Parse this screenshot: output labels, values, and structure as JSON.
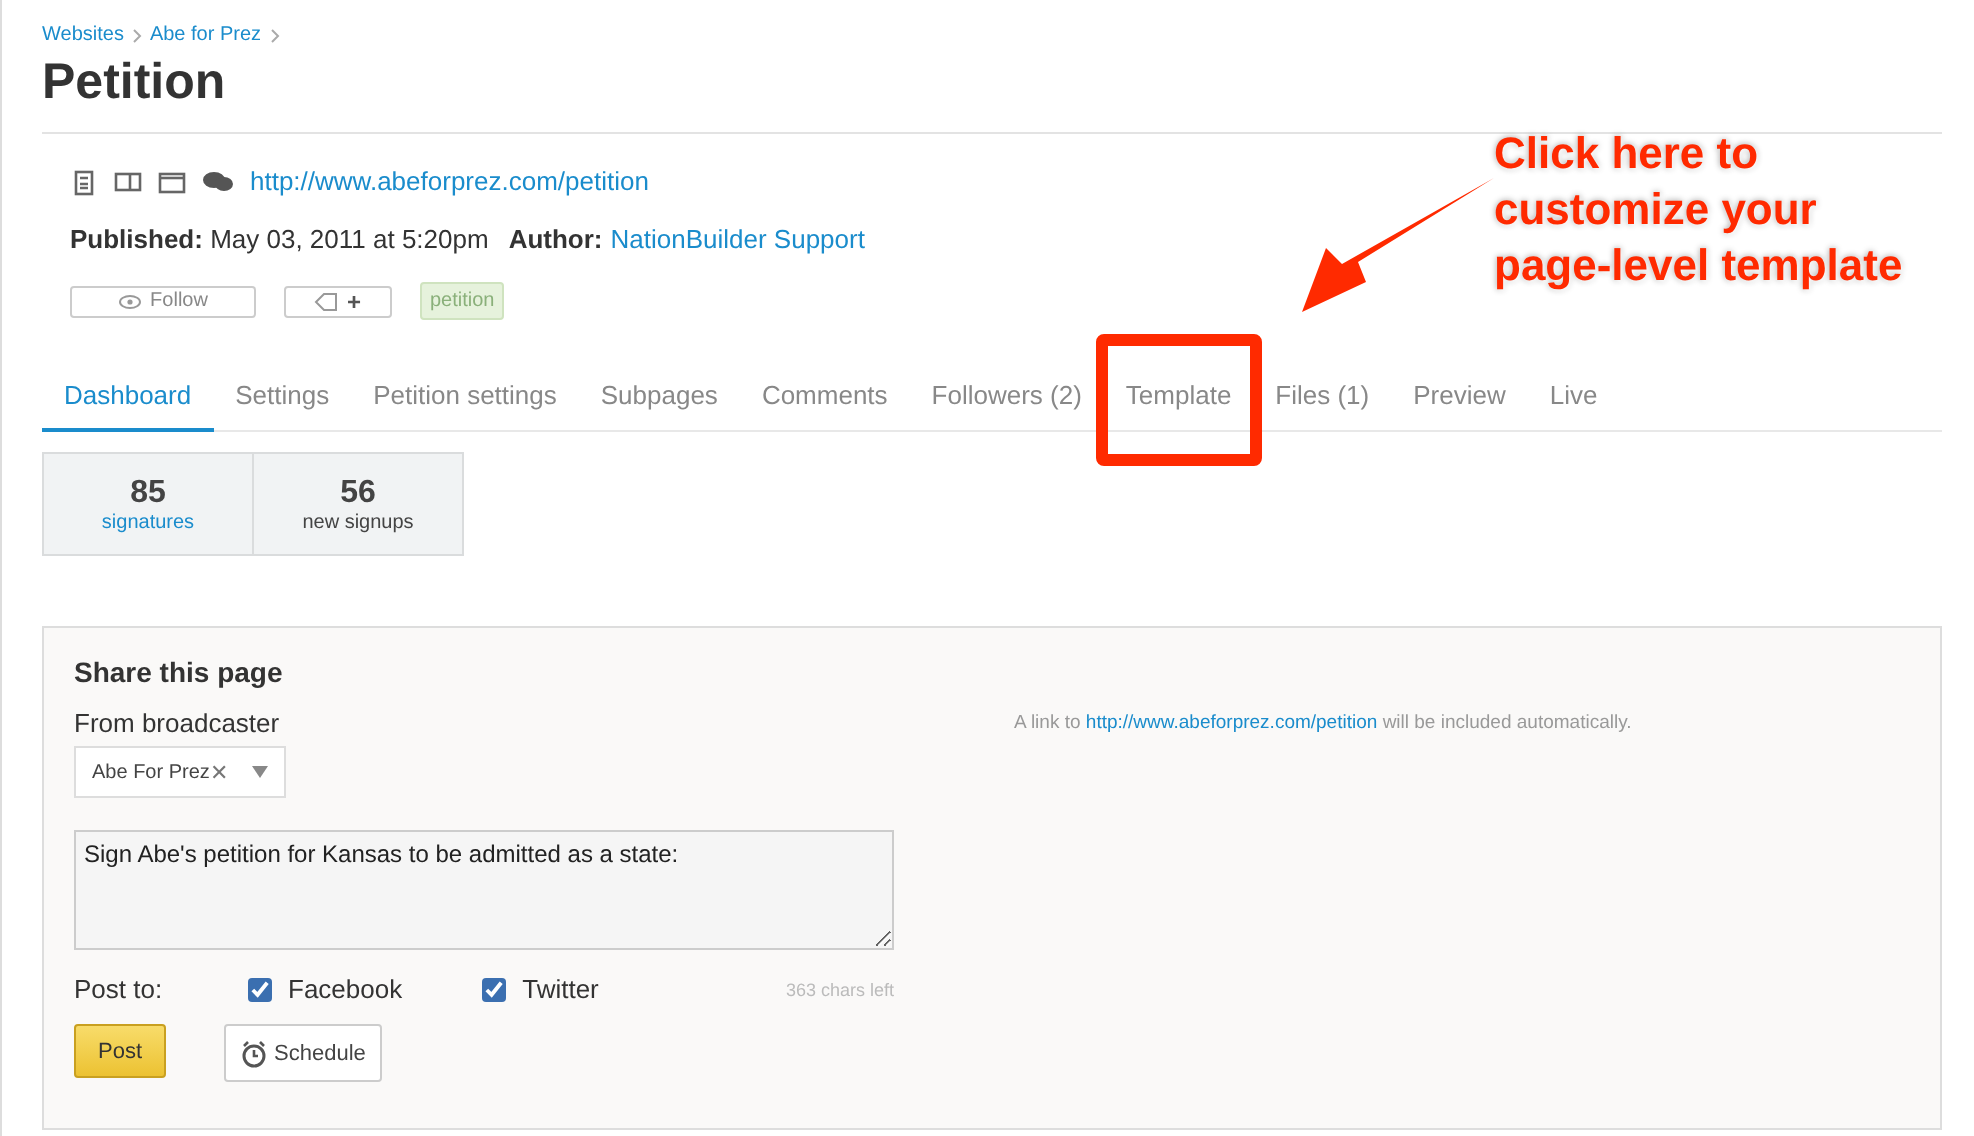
{
  "breadcrumb": [
    "Websites",
    "Abe for Prez"
  ],
  "title": "Petition",
  "page_url": "http://www.abeforprez.com/petition",
  "published": {
    "label": "Published:",
    "value": "May 03, 2011 at 5:20pm",
    "author_label": "Author:",
    "author": "NationBuilder Support"
  },
  "follow_button": "Follow",
  "tag_button": "+",
  "tags": [
    "petition"
  ],
  "tabs": [
    {
      "label": "Dashboard",
      "selected": true
    },
    {
      "label": "Settings",
      "selected": false
    },
    {
      "label": "Petition settings",
      "selected": false
    },
    {
      "label": "Subpages",
      "selected": false
    },
    {
      "label": "Comments",
      "selected": false
    },
    {
      "label": "Followers (2)",
      "selected": false
    },
    {
      "label": "Template",
      "selected": false,
      "highlighted": true
    },
    {
      "label": "Files (1)",
      "selected": false
    },
    {
      "label": "Preview",
      "selected": false
    },
    {
      "label": "Live",
      "selected": false
    }
  ],
  "stats": [
    {
      "value": "85",
      "label": "signatures",
      "link": true
    },
    {
      "value": "56",
      "label": "new signups",
      "link": false
    }
  ],
  "share": {
    "title": "Share this page",
    "from_label": "From broadcaster",
    "broadcaster": "Abe For Prez",
    "clear": "✕",
    "message": "Sign Abe's petition for Kansas to be admitted as a state:",
    "note_before": "A link to",
    "note_link": "http://www.abeforprez.com/petition",
    "note_after": "will be included automatically.",
    "post_to": "Post to:",
    "networks": [
      {
        "label": "Facebook",
        "checked": true
      },
      {
        "label": "Twitter",
        "checked": true
      }
    ],
    "chars_left": "363 chars left",
    "post_button": "Post",
    "schedule_button": "Schedule"
  },
  "annotation": {
    "lines": [
      "Click here to",
      "customize your",
      "page-level template"
    ]
  }
}
